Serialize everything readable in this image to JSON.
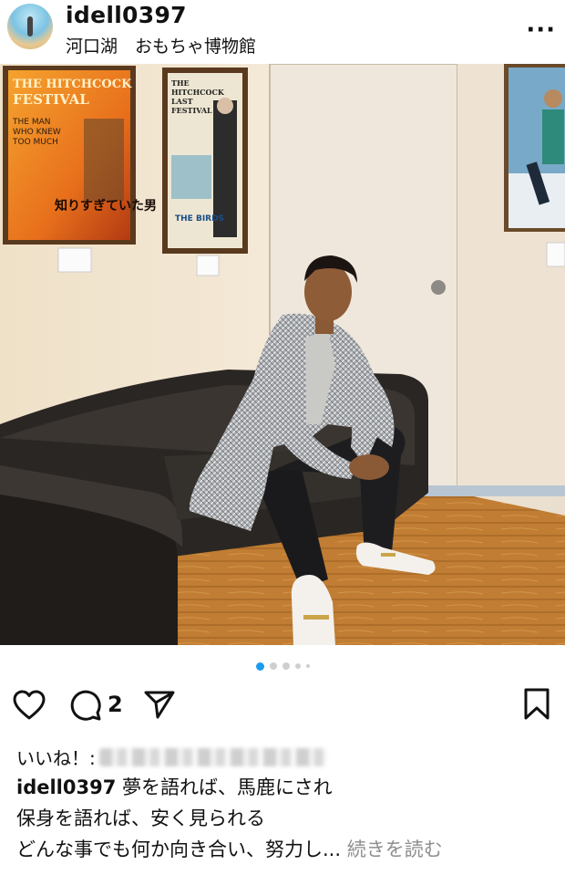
{
  "post": {
    "username": "idell0397",
    "location": "河口湖　おもちゃ博物館",
    "more_icon": "ellipsis-icon"
  },
  "photo": {
    "poster_left": {
      "title_lines": [
        "THE HITCHCOCK",
        "FESTIVAL"
      ],
      "subtitle_lines": [
        "THE MAN",
        "WHO KNEW",
        "TOO MUCH"
      ],
      "jp_title": "知りすぎていた男"
    },
    "poster_mid": {
      "title_lines": [
        "THE",
        "HITCHCOCK",
        "LAST",
        "FESTIVAL"
      ],
      "film": "THE BIRDS"
    }
  },
  "carousel": {
    "count": 5,
    "active": 0
  },
  "actions": {
    "like_icon": "heart-icon",
    "comment_icon": "comment-icon",
    "comment_count": "2",
    "share_icon": "send-icon",
    "save_icon": "bookmark-icon"
  },
  "likes": {
    "prefix": "いいね！:"
  },
  "caption": {
    "username": "idell0397",
    "line1": "夢を語れば、馬鹿にされ",
    "line2": "保身を語れば、安く見られる",
    "line3": "どんな事でも何か向き合い、努力し...",
    "more_label": "続きを読む"
  }
}
